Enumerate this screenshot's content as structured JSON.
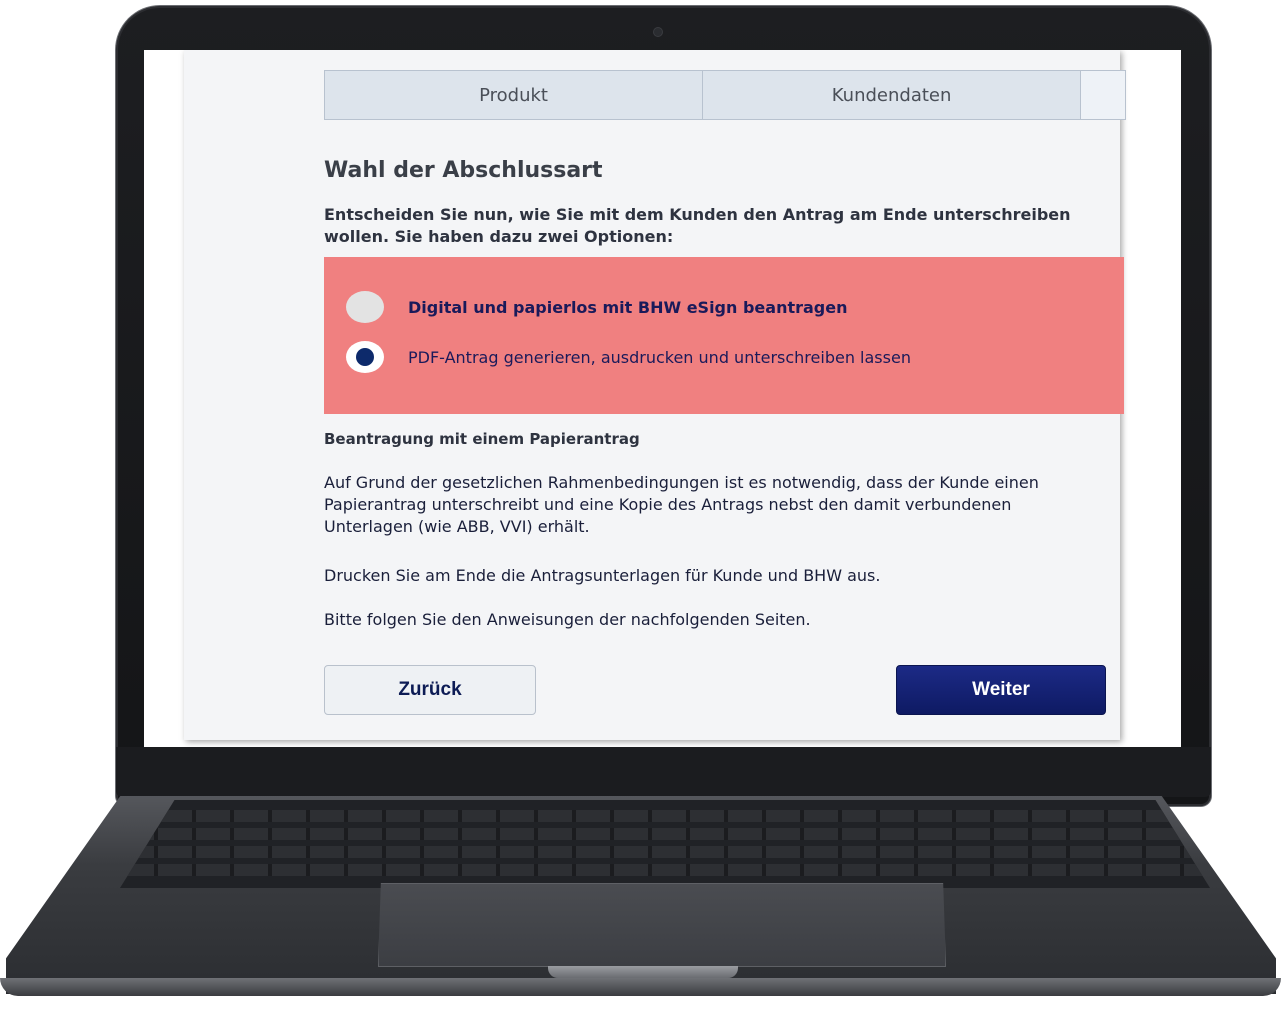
{
  "tabs": [
    "Produkt",
    "Kundendaten",
    ""
  ],
  "section": {
    "title": "Wahl der Abschlussart",
    "intro": "Entscheiden Sie nun, wie Sie mit dem Kunden den Antrag am Ende unterschreiben wollen. Sie haben dazu zwei Optionen:"
  },
  "options": [
    {
      "label": "Digital und papierlos mit BHW eSign beantragen",
      "selected": false
    },
    {
      "label": "PDF-Antrag generieren, ausdrucken und unterschreiben lassen",
      "selected": true
    }
  ],
  "info": {
    "subtitle": "Beantragung mit einem Papierantrag",
    "p1": "Auf Grund der gesetzlichen Rahmenbedingungen ist es notwendig, dass der Kunde einen Papierantrag unterschreibt und eine Kopie des Antrags nebst den damit verbundenen Unterlagen (wie ABB, VVI) erhält.",
    "p2": "Drucken Sie am Ende die Antragsunterlagen für Kunde und BHW aus.",
    "p3": "Bitte folgen Sie den Anweisungen der nachfolgenden Seiten."
  },
  "buttons": {
    "back": "Zurück",
    "next": "Weiter"
  },
  "colors": {
    "option_box": "#f08080",
    "primary_button": "#1c2a86",
    "radio_selected": "#0d2a6b"
  }
}
